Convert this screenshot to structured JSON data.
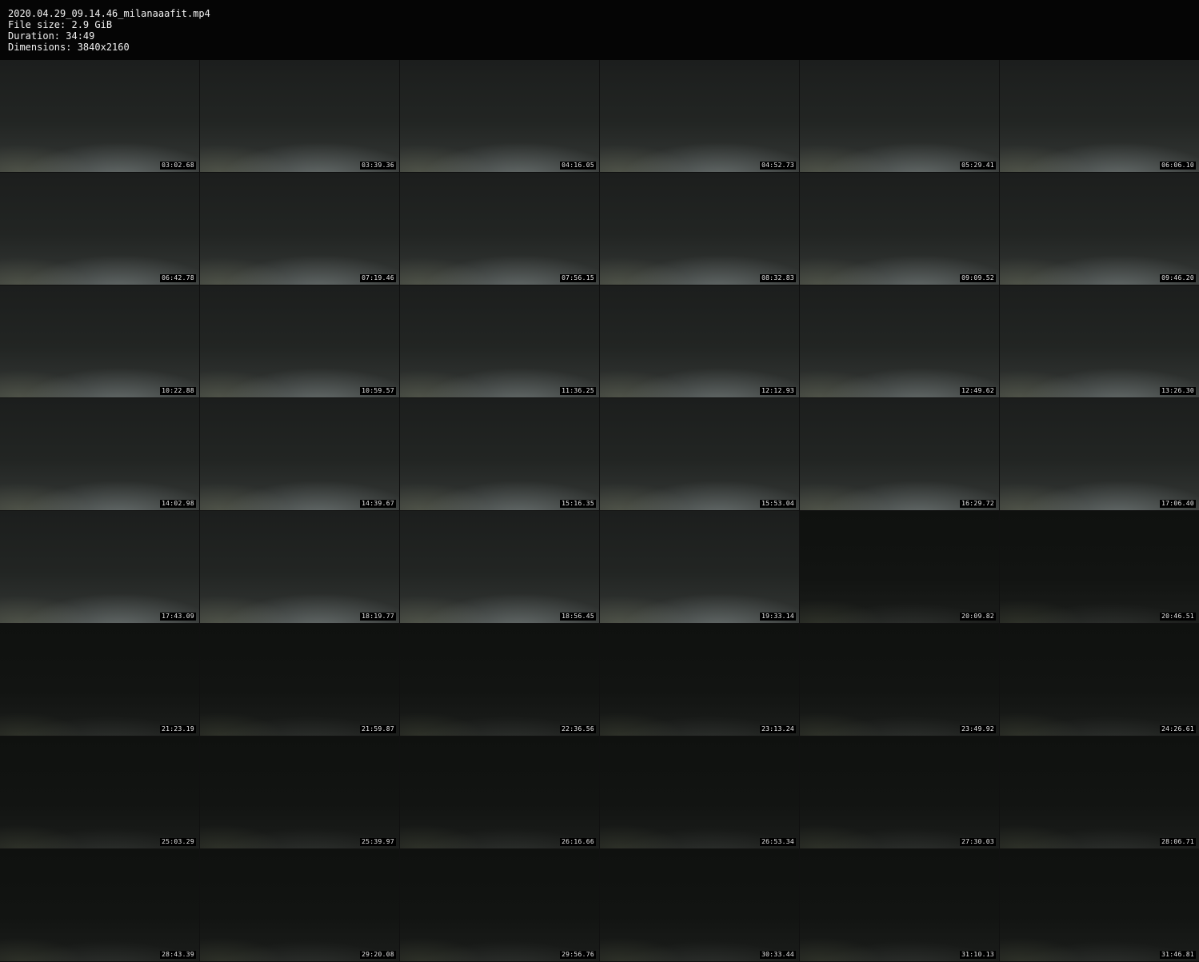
{
  "header": {
    "filename": "2020.04.29_09.14.46_milanaaafit.mp4",
    "file_size": "File size: 2.9 GiB",
    "duration": "Duration: 34:49",
    "dimensions": "Dimensions: 3840x2160"
  },
  "thumbnails": [
    {
      "timestamp": "03:02.68",
      "tone": "lit"
    },
    {
      "timestamp": "03:39.36",
      "tone": "lit"
    },
    {
      "timestamp": "04:16.05",
      "tone": "lit"
    },
    {
      "timestamp": "04:52.73",
      "tone": "lit"
    },
    {
      "timestamp": "05:29.41",
      "tone": "lit"
    },
    {
      "timestamp": "06:06.10",
      "tone": "lit"
    },
    {
      "timestamp": "06:42.78",
      "tone": "lit"
    },
    {
      "timestamp": "07:19.46",
      "tone": "lit"
    },
    {
      "timestamp": "07:56.15",
      "tone": "lit"
    },
    {
      "timestamp": "08:32.83",
      "tone": "lit"
    },
    {
      "timestamp": "09:09.52",
      "tone": "lit"
    },
    {
      "timestamp": "09:46.20",
      "tone": "lit"
    },
    {
      "timestamp": "10:22.88",
      "tone": "lit"
    },
    {
      "timestamp": "10:59.57",
      "tone": "lit"
    },
    {
      "timestamp": "11:36.25",
      "tone": "lit"
    },
    {
      "timestamp": "12:12.93",
      "tone": "lit"
    },
    {
      "timestamp": "12:49.62",
      "tone": "lit"
    },
    {
      "timestamp": "13:26.30",
      "tone": "lit"
    },
    {
      "timestamp": "14:02.98",
      "tone": "lit"
    },
    {
      "timestamp": "14:39.67",
      "tone": "lit"
    },
    {
      "timestamp": "15:16.35",
      "tone": "lit"
    },
    {
      "timestamp": "15:53.04",
      "tone": "lit"
    },
    {
      "timestamp": "16:29.72",
      "tone": "lit"
    },
    {
      "timestamp": "17:06.40",
      "tone": "lit"
    },
    {
      "timestamp": "17:43.09",
      "tone": "lit"
    },
    {
      "timestamp": "18:19.77",
      "tone": "lit"
    },
    {
      "timestamp": "18:56.45",
      "tone": "lit"
    },
    {
      "timestamp": "19:33.14",
      "tone": "lit"
    },
    {
      "timestamp": "20:09.82",
      "tone": "dark"
    },
    {
      "timestamp": "20:46.51",
      "tone": "dark"
    },
    {
      "timestamp": "21:23.19",
      "tone": "dark"
    },
    {
      "timestamp": "21:59.87",
      "tone": "dark"
    },
    {
      "timestamp": "22:36.56",
      "tone": "dark"
    },
    {
      "timestamp": "23:13.24",
      "tone": "dark"
    },
    {
      "timestamp": "23:49.92",
      "tone": "dark"
    },
    {
      "timestamp": "24:26.61",
      "tone": "dark"
    },
    {
      "timestamp": "25:03.29",
      "tone": "dark"
    },
    {
      "timestamp": "25:39.97",
      "tone": "dark"
    },
    {
      "timestamp": "26:16.66",
      "tone": "dark"
    },
    {
      "timestamp": "26:53.34",
      "tone": "dark"
    },
    {
      "timestamp": "27:30.03",
      "tone": "dark"
    },
    {
      "timestamp": "28:06.71",
      "tone": "dark"
    },
    {
      "timestamp": "28:43.39",
      "tone": "dark"
    },
    {
      "timestamp": "29:20.08",
      "tone": "dark"
    },
    {
      "timestamp": "29:56.76",
      "tone": "dark"
    },
    {
      "timestamp": "30:33.44",
      "tone": "dark"
    },
    {
      "timestamp": "31:10.13",
      "tone": "dark"
    },
    {
      "timestamp": "31:46.81",
      "tone": "dark"
    }
  ]
}
